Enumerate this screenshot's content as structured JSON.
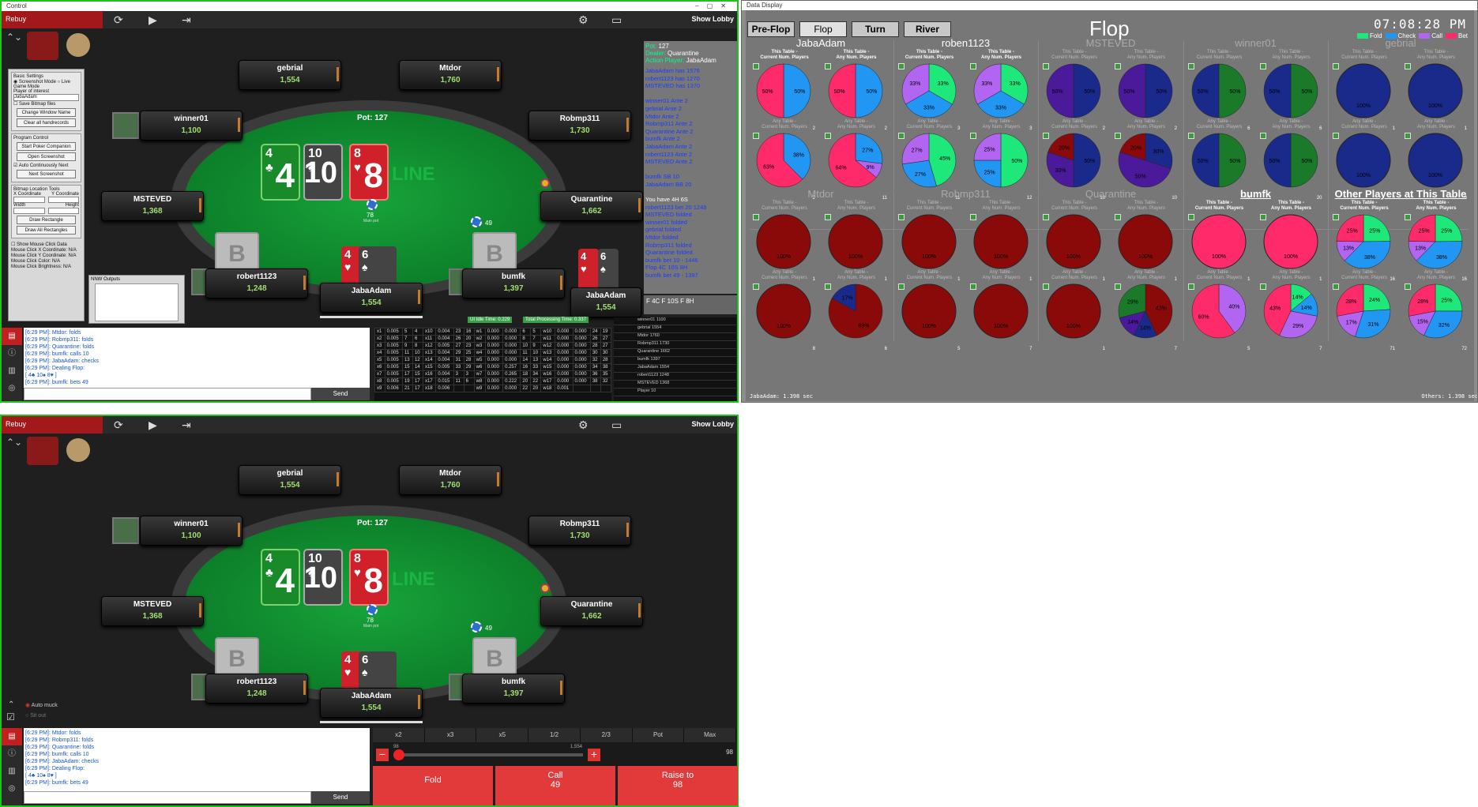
{
  "control": {
    "title": "Control",
    "rebuy": "Rebuy",
    "show_lobby": "Show Lobby",
    "pot": "Pot: 127",
    "line_logo": "LINE",
    "main_pot": "78",
    "main_pot_label": "Main pot",
    "bet_bumfk": "49",
    "board": [
      {
        "rank": "4",
        "suit": "♣",
        "big": "4",
        "cls": "c-club"
      },
      {
        "rank": "10",
        "suit": "♠",
        "big": "10",
        "cls": "c-spade"
      },
      {
        "rank": "8",
        "suit": "♥",
        "big": "8",
        "cls": "c-heart"
      }
    ],
    "seats": {
      "gebrial": {
        "name": "gebrial",
        "stack": "1,554"
      },
      "mtdor": {
        "name": "Mtdor",
        "stack": "1,760"
      },
      "winner01": {
        "name": "winner01",
        "stack": "1,100"
      },
      "robmp311": {
        "name": "Robmp311",
        "stack": "1,730"
      },
      "msteved": {
        "name": "MSTEVED",
        "stack": "1,368"
      },
      "quarantine": {
        "name": "Quarantine",
        "stack": "1,662"
      },
      "robert1123": {
        "name": "robert1123",
        "stack": "1,248"
      },
      "bumfk": {
        "name": "bumfk",
        "stack": "1,397"
      },
      "jabaadam": {
        "name": "JabaAdam",
        "stack": "1,554"
      }
    },
    "hero_cards": [
      {
        "rank": "4",
        "suit": "♥"
      },
      {
        "rank": "6",
        "suit": "♠"
      }
    ],
    "hidden_card": "B",
    "left_panel": {
      "basic_settings": "Basic Settings",
      "screenshot_mode": "Screenshot Mode",
      "live_game_mode": "Live Game Mode",
      "player_of_interest": "Player of interest",
      "player_value": "JabaAdam",
      "save_bitmap": "Save Bitmap files",
      "change_window": "Change Window Name",
      "clear_handrecs": "Clear all handrecords",
      "program_control": "Program Control",
      "start_poker": "Start Poker Companion",
      "open_screenshot": "Open Screenshot",
      "auto_continue": "Auto Continuously Next",
      "next_screenshot": "Next Screenshot",
      "bitmap_tools": "Bitmap Location Tools",
      "x_coord": "X Coordinate",
      "y_coord": "Y Coordinate",
      "width": "Width",
      "height": "Height",
      "draw_rect": "Draw Rectangle",
      "draw_all": "Draw All Rectangles",
      "show_mouse": "Show Mouse Click Data",
      "mx": "Mouse Click X Coordinate: N/A",
      "my": "Mouse Click Y Coordinate: N/A",
      "mc": "Mouse Click Color: N/A",
      "mb": "Mouse Click Brightness: N/A",
      "nnw_outputs": "NNW Outputs"
    },
    "info": {
      "pot_label": "Pot:",
      "pot_val": "127",
      "dealer_label": "Dealer:",
      "dealer_val": "Quarantine",
      "action_label": "Action Player:",
      "action_val": "JabaAdam",
      "lines": [
        {
          "t": "JabaAdam  has 1576",
          "c": "b"
        },
        {
          "t": "robert1123  has 1270",
          "c": "b"
        },
        {
          "t": "MSTEVED  has 1370",
          "c": "b"
        },
        {
          "t": "",
          "c": "b"
        },
        {
          "t": "winner01  Ante 2",
          "c": "b"
        },
        {
          "t": "gebrial  Ante 2",
          "c": "b"
        },
        {
          "t": "Mtdor  Ante 2",
          "c": "b"
        },
        {
          "t": "Robmp311  Ante 2",
          "c": "b"
        },
        {
          "t": "Quarantine  Ante 2",
          "c": "b"
        },
        {
          "t": "bumfk  Ante 2",
          "c": "b"
        },
        {
          "t": "JabaAdam  Ante 2",
          "c": "b"
        },
        {
          "t": "robert1123  Ante 2",
          "c": "b"
        },
        {
          "t": "MSTEVED  Ante 2",
          "c": "b"
        },
        {
          "t": "",
          "c": "b"
        },
        {
          "t": "bumfk  SB 10",
          "c": "b"
        },
        {
          "t": "JabaAdam  BB 20",
          "c": "b"
        },
        {
          "t": "",
          "c": "b"
        },
        {
          "t": "You have  4H 6S",
          "c": "w"
        },
        {
          "t": "robert1123  bet 20  1248",
          "c": "b"
        },
        {
          "t": "MSTEVED  folded",
          "c": "b"
        },
        {
          "t": "winner01  folded",
          "c": "b"
        },
        {
          "t": "gebrial  folded",
          "c": "b"
        },
        {
          "t": "Mtdor  folded",
          "c": "b"
        },
        {
          "t": "Robmp311  folded",
          "c": "b"
        },
        {
          "t": "Quarantine  folded",
          "c": "b"
        },
        {
          "t": "bumfk  bet 10 - 1446",
          "c": "b"
        },
        {
          "t": "Flop  4C  10S  8H",
          "c": "b"
        },
        {
          "t": "bumfk  bet 49 - 1397",
          "c": "b"
        }
      ],
      "bottom": "F 4C    F 10S    F 8H"
    },
    "chat": [
      "[6:29 PM]: Mtdor: folds",
      "[6:29 PM]: Robmp311: folds",
      "[6:29 PM]: Quarantine: folds",
      "[6:29 PM]: bumfk: calls 10",
      "[6:29 PM]: JabaAdam: checks",
      "[6:29 PM]: Dealing Flop:",
      "[ 4♣ 10♠ 8♥ ]",
      "[6:29 PM]: bumfk: bets 49"
    ],
    "send": "Send",
    "timing": {
      "idle": "UI Idle Time: 0.229",
      "proc": "Total Processing Time: 0.337"
    },
    "grid_right": [
      "winner01 1100",
      "gebrial 1554",
      "Mtdor 1760",
      "Robmp311 1730",
      "Quarantine 1662",
      "bumfk 1397",
      "JabaAdam 1554",
      "robert1123 1248",
      "MSTEVED 1368",
      "Player 10"
    ],
    "grid_rows": [
      [
        "x1",
        "0.005",
        "5",
        "4",
        "x10",
        "0.004",
        "23",
        "16",
        "w1",
        "0.000",
        "0.000",
        "6",
        "5",
        "w10",
        "0.000",
        "0.000",
        "24",
        "19"
      ],
      [
        "x2",
        "0.005",
        "7",
        "6",
        "x11",
        "0.004",
        "26",
        "20",
        "w2",
        "0.000",
        "0.000",
        "8",
        "7",
        "w11",
        "0.000",
        "0.000",
        "26",
        "27"
      ],
      [
        "x3",
        "0.005",
        "9",
        "8",
        "x12",
        "0.005",
        "27",
        "23",
        "w3",
        "0.000",
        "0.000",
        "10",
        "9",
        "w12",
        "0.000",
        "0.000",
        "28",
        "27"
      ],
      [
        "x4",
        "0.005",
        "11",
        "10",
        "x13",
        "0.004",
        "29",
        "25",
        "w4",
        "0.000",
        "0.000",
        "11",
        "10",
        "w13",
        "0.000",
        "0.000",
        "30",
        "30"
      ],
      [
        "x5",
        "0.005",
        "13",
        "12",
        "x14",
        "0.004",
        "31",
        "28",
        "w5",
        "0.000",
        "0.000",
        "14",
        "13",
        "w14",
        "0.000",
        "0.000",
        "32",
        "28"
      ],
      [
        "x6",
        "0.005",
        "15",
        "14",
        "x15",
        "0.005",
        "33",
        "29",
        "w6",
        "0.000",
        "0.257",
        "16",
        "33",
        "w15",
        "0.000",
        "0.000",
        "34",
        "38"
      ],
      [
        "x7",
        "0.005",
        "17",
        "15",
        "x16",
        "0.004",
        "3",
        "3",
        "w7",
        "0.000",
        "0.265",
        "18",
        "34",
        "w16",
        "0.000",
        "0.000",
        "36",
        "35"
      ],
      [
        "x8",
        "0.005",
        "19",
        "17",
        "x17",
        "0.015",
        "11",
        "6",
        "w8",
        "0.000",
        "0.222",
        "20",
        "22",
        "w17",
        "0.000",
        "0.000",
        "38",
        "32"
      ],
      [
        "x9",
        "0.006",
        "21",
        "17",
        "x18",
        "0.006",
        "",
        "",
        "w9",
        "0.000",
        "0.000",
        "22",
        "20",
        "w18",
        "0.001",
        "",
        "",
        " "
      ]
    ]
  },
  "control2": {
    "auto_muck": "Auto muck",
    "sit_out": "Sit out",
    "chat": [
      "[6:29 PM]: Mtdor: folds",
      "[6:29 PM]: Robmp311: folds",
      "[6:29 PM]: Quarantine: folds",
      "[6:29 PM]: bumfk: calls 10",
      "[6:29 PM]: JabaAdam: checks",
      "[6:29 PM]: Dealing Flop:",
      "[ 4♣ 10♠ 8♥ ]",
      "[6:29 PM]: bumfk: bets 49"
    ],
    "bet_presets": [
      "x2",
      "x3",
      "x5",
      "1/2",
      "2/3",
      "Pot",
      "Max"
    ],
    "slider_min": "98",
    "slider_max": "1,554",
    "slider_value": "98",
    "fold": "Fold",
    "call": "Call",
    "call_amt": "49",
    "raise": "Raise to",
    "raise_amt": "98"
  },
  "data_display": {
    "title": "Data Display",
    "streets": [
      "Pre-Flop",
      "Flop",
      "Turn",
      "River"
    ],
    "active_street": "Flop",
    "heading": "Flop",
    "clock": "07:08:28 PM",
    "legend": [
      {
        "label": "Fold",
        "color": "#1ee87a"
      },
      {
        "label": "Check",
        "color": "#2196f3"
      },
      {
        "label": "Call",
        "color": "#b265f0"
      },
      {
        "label": "Bet",
        "color": "#ff2a6a"
      }
    ],
    "this_cur": "This Table -\nCurrent Num. Players",
    "this_any": "This Table -\nAny Num. Players",
    "any_cur": "Any Table -\nCurrent Num. Players",
    "any_any": "Any Table -\nAny Num. Players",
    "status_left": "JabaAdam: 1.398 sec",
    "status_right": "Others: 1.398 sec",
    "players": [
      {
        "name": "JabaAdam",
        "style": "",
        "charts": [
          {
            "s": [
              0,
              50,
              0,
              50
            ],
            "n": "2"
          },
          {
            "s": [
              0,
              50,
              0,
              50
            ],
            "n": "2"
          },
          {
            "s": [
              0,
              38,
              0,
              63
            ],
            "n": "2"
          },
          {
            "s": [
              0,
              27,
              9,
              64
            ],
            "n": "11"
          }
        ]
      },
      {
        "name": "roben1123",
        "style": "",
        "charts": [
          {
            "s": [
              33,
              33,
              33,
              0
            ],
            "n": "3"
          },
          {
            "s": [
              33,
              33,
              33,
              0
            ],
            "n": "3"
          },
          {
            "s": [
              45,
              27,
              27,
              0
            ],
            "n": "11"
          },
          {
            "s": [
              50,
              25,
              25,
              0
            ],
            "n": "12"
          }
        ]
      },
      {
        "name": "MSTEVED",
        "style": "dim",
        "charts": [
          {
            "s": [
              0,
              50,
              50,
              0
            ],
            "n": "2",
            "dark": true
          },
          {
            "s": [
              0,
              50,
              50,
              0
            ],
            "n": "2",
            "dark": true
          },
          {
            "s": [
              0,
              50,
              30,
              20
            ],
            "n": "10",
            "dark": true
          },
          {
            "s": [
              0,
              30,
              50,
              20
            ],
            "n": "10",
            "dark": true
          }
        ]
      },
      {
        "name": "winner01",
        "style": "dim",
        "charts": [
          {
            "s": [
              50,
              50,
              0,
              0
            ],
            "n": "6",
            "dark": true
          },
          {
            "s": [
              50,
              50,
              0,
              0
            ],
            "n": "6",
            "dark": true
          },
          {
            "s": [
              50,
              50,
              0,
              0
            ],
            "n": "18",
            "dark": true
          },
          {
            "s": [
              50,
              50,
              0,
              0
            ],
            "n": "20",
            "dark": true
          }
        ]
      },
      {
        "name": "gebrial",
        "style": "dim",
        "charts": [
          {
            "s": [
              0,
              100,
              0,
              0
            ],
            "n": "1",
            "dark": true
          },
          {
            "s": [
              0,
              100,
              0,
              0
            ],
            "n": "1",
            "dark": true
          },
          {
            "s": [
              0,
              100,
              0,
              0
            ],
            "n": "3",
            "dark": true
          },
          {
            "s": [
              0,
              100,
              0,
              0
            ],
            "n": "3",
            "dark": true
          }
        ]
      },
      {
        "name": "Mtdor",
        "style": "dim",
        "charts": [
          {
            "s": [
              100,
              0,
              0,
              0
            ],
            "n": "1",
            "red": true
          },
          {
            "s": [
              100,
              0,
              0,
              0
            ],
            "n": "1",
            "red": true
          },
          {
            "s": [
              100,
              0,
              0,
              0
            ],
            "n": "8",
            "red": true
          },
          {
            "s": [
              83,
              17,
              0,
              0
            ],
            "n": "6",
            "red": true
          }
        ]
      },
      {
        "name": "Robmp311",
        "style": "dim",
        "charts": [
          {
            "s": [
              100,
              0,
              0,
              0
            ],
            "n": "1",
            "red": true
          },
          {
            "s": [
              100,
              0,
              0,
              0
            ],
            "n": "1",
            "red": true
          },
          {
            "s": [
              100,
              0,
              0,
              0
            ],
            "n": "5",
            "red": true
          },
          {
            "s": [
              100,
              0,
              0,
              0
            ],
            "n": "7",
            "red": true
          }
        ]
      },
      {
        "name": "Quarantine",
        "style": "dim",
        "charts": [
          {
            "s": [
              100,
              0,
              0,
              0
            ],
            "n": "1",
            "red": true
          },
          {
            "s": [
              100,
              0,
              0,
              0
            ],
            "n": "1",
            "red": true
          },
          {
            "s": [
              100,
              0,
              0,
              0
            ],
            "n": "1",
            "red": true
          },
          {
            "s": [
              43,
              14,
              14,
              29
            ],
            "n": "7",
            "red": true
          }
        ]
      },
      {
        "name": "bumfk",
        "style": "ul",
        "charts": [
          {
            "s": [
              0,
              0,
              0,
              100
            ],
            "n": "1"
          },
          {
            "s": [
              0,
              0,
              0,
              100
            ],
            "n": "1"
          },
          {
            "s": [
              0,
              0,
              40,
              60
            ],
            "n": "5"
          },
          {
            "s": [
              14,
              14,
              29,
              43
            ],
            "n": "7"
          }
        ]
      },
      {
        "name": "Other Players at This Table",
        "style": "ul",
        "charts": [
          {
            "s": [
              25,
              38,
              13,
              25
            ],
            "n": "16"
          },
          {
            "s": [
              25,
              38,
              13,
              25
            ],
            "n": "16"
          },
          {
            "s": [
              24,
              31,
              17,
              28
            ],
            "n": "71"
          },
          {
            "s": [
              25,
              32,
              15,
              28
            ],
            "n": "72"
          }
        ]
      }
    ]
  }
}
